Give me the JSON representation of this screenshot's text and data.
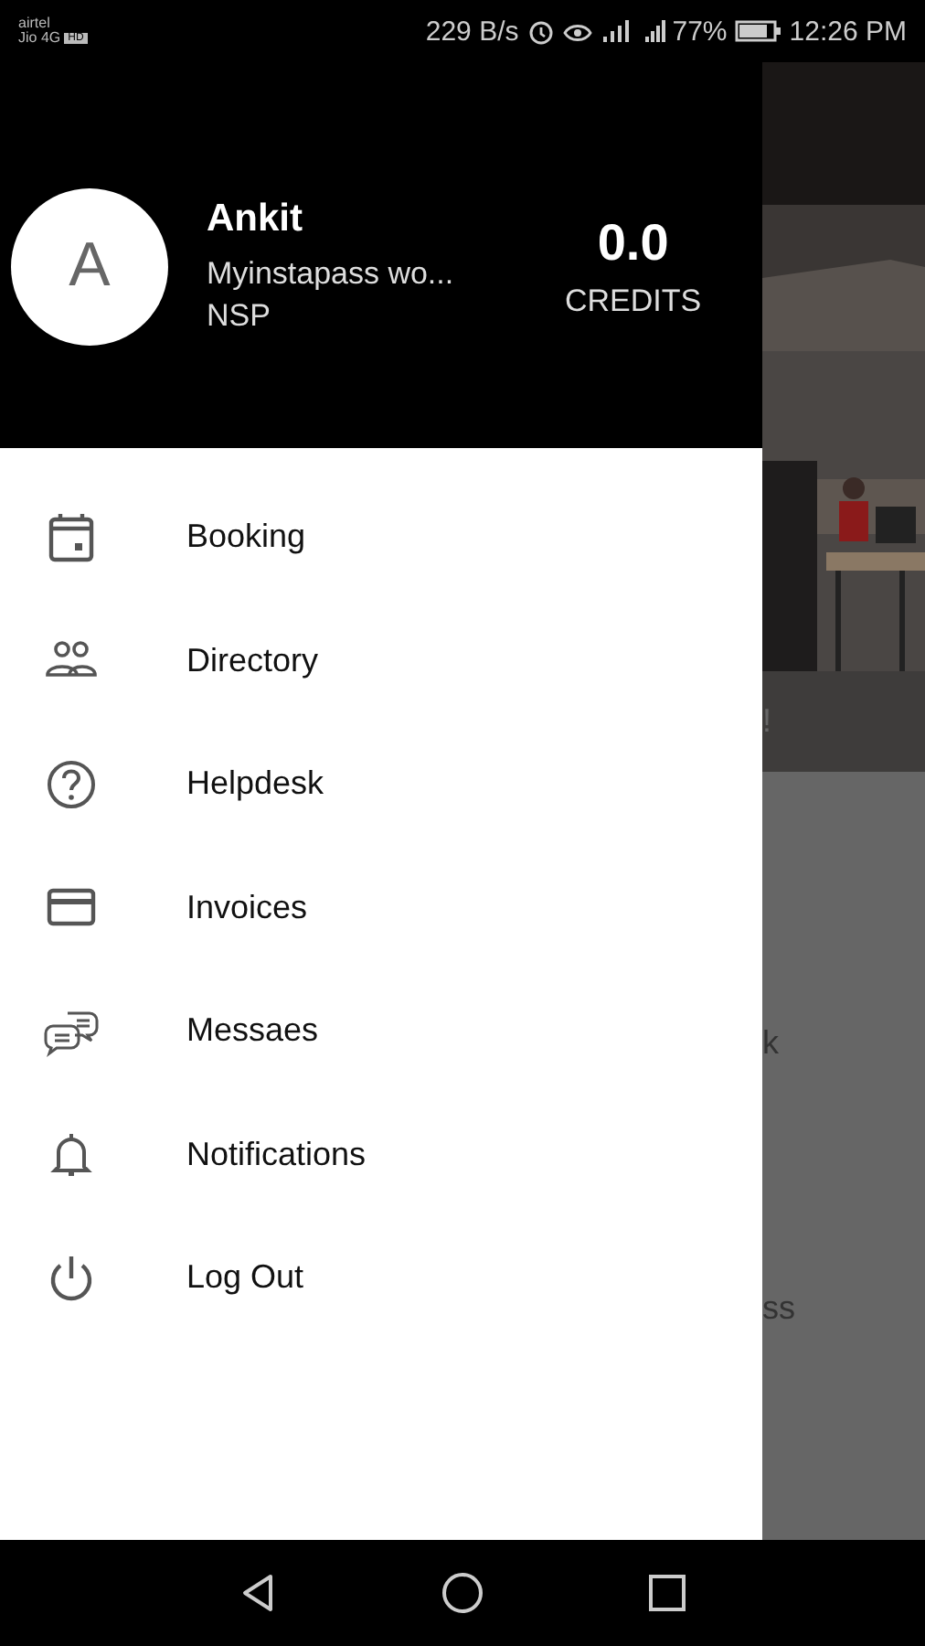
{
  "status_bar": {
    "carrier_1": "airtel",
    "carrier_2": "Jio 4G",
    "network_badge": "HD",
    "speed": "229 B/s",
    "battery": "77%",
    "time": "12:26 PM"
  },
  "drawer": {
    "avatar_letter": "A",
    "name": "Ankit",
    "company": "Myinstapass wo...",
    "location": "NSP",
    "credits_value": "0.0",
    "credits_label": "CREDITS",
    "items": [
      {
        "label": "Booking",
        "kind": "calendar"
      },
      {
        "label": "Directory",
        "kind": "people"
      },
      {
        "label": "Helpdesk",
        "kind": "help"
      },
      {
        "label": "Invoices",
        "kind": "card"
      },
      {
        "label": "Messaes",
        "kind": "chat"
      },
      {
        "label": "Notifications",
        "kind": "bell"
      },
      {
        "label": "Log Out",
        "kind": "power"
      }
    ]
  },
  "background": {
    "banner_fragment": "!",
    "text_fragment_1": "k",
    "text_fragment_2": "ss"
  }
}
